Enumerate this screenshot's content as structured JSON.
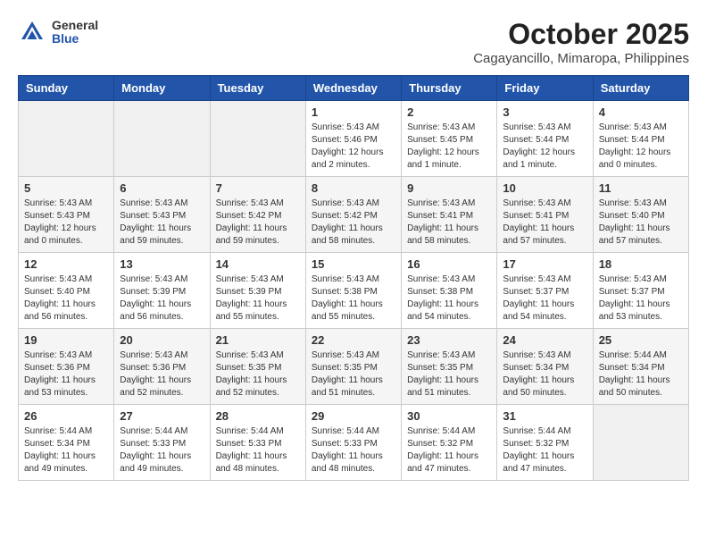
{
  "header": {
    "logo_general": "General",
    "logo_blue": "Blue",
    "month": "October 2025",
    "location": "Cagayancillo, Mimaropa, Philippines"
  },
  "weekdays": [
    "Sunday",
    "Monday",
    "Tuesday",
    "Wednesday",
    "Thursday",
    "Friday",
    "Saturday"
  ],
  "weeks": [
    [
      {
        "day": "",
        "info": ""
      },
      {
        "day": "",
        "info": ""
      },
      {
        "day": "",
        "info": ""
      },
      {
        "day": "1",
        "info": "Sunrise: 5:43 AM\nSunset: 5:46 PM\nDaylight: 12 hours\nand 2 minutes."
      },
      {
        "day": "2",
        "info": "Sunrise: 5:43 AM\nSunset: 5:45 PM\nDaylight: 12 hours\nand 1 minute."
      },
      {
        "day": "3",
        "info": "Sunrise: 5:43 AM\nSunset: 5:44 PM\nDaylight: 12 hours\nand 1 minute."
      },
      {
        "day": "4",
        "info": "Sunrise: 5:43 AM\nSunset: 5:44 PM\nDaylight: 12 hours\nand 0 minutes."
      }
    ],
    [
      {
        "day": "5",
        "info": "Sunrise: 5:43 AM\nSunset: 5:43 PM\nDaylight: 12 hours\nand 0 minutes."
      },
      {
        "day": "6",
        "info": "Sunrise: 5:43 AM\nSunset: 5:43 PM\nDaylight: 11 hours\nand 59 minutes."
      },
      {
        "day": "7",
        "info": "Sunrise: 5:43 AM\nSunset: 5:42 PM\nDaylight: 11 hours\nand 59 minutes."
      },
      {
        "day": "8",
        "info": "Sunrise: 5:43 AM\nSunset: 5:42 PM\nDaylight: 11 hours\nand 58 minutes."
      },
      {
        "day": "9",
        "info": "Sunrise: 5:43 AM\nSunset: 5:41 PM\nDaylight: 11 hours\nand 58 minutes."
      },
      {
        "day": "10",
        "info": "Sunrise: 5:43 AM\nSunset: 5:41 PM\nDaylight: 11 hours\nand 57 minutes."
      },
      {
        "day": "11",
        "info": "Sunrise: 5:43 AM\nSunset: 5:40 PM\nDaylight: 11 hours\nand 57 minutes."
      }
    ],
    [
      {
        "day": "12",
        "info": "Sunrise: 5:43 AM\nSunset: 5:40 PM\nDaylight: 11 hours\nand 56 minutes."
      },
      {
        "day": "13",
        "info": "Sunrise: 5:43 AM\nSunset: 5:39 PM\nDaylight: 11 hours\nand 56 minutes."
      },
      {
        "day": "14",
        "info": "Sunrise: 5:43 AM\nSunset: 5:39 PM\nDaylight: 11 hours\nand 55 minutes."
      },
      {
        "day": "15",
        "info": "Sunrise: 5:43 AM\nSunset: 5:38 PM\nDaylight: 11 hours\nand 55 minutes."
      },
      {
        "day": "16",
        "info": "Sunrise: 5:43 AM\nSunset: 5:38 PM\nDaylight: 11 hours\nand 54 minutes."
      },
      {
        "day": "17",
        "info": "Sunrise: 5:43 AM\nSunset: 5:37 PM\nDaylight: 11 hours\nand 54 minutes."
      },
      {
        "day": "18",
        "info": "Sunrise: 5:43 AM\nSunset: 5:37 PM\nDaylight: 11 hours\nand 53 minutes."
      }
    ],
    [
      {
        "day": "19",
        "info": "Sunrise: 5:43 AM\nSunset: 5:36 PM\nDaylight: 11 hours\nand 53 minutes."
      },
      {
        "day": "20",
        "info": "Sunrise: 5:43 AM\nSunset: 5:36 PM\nDaylight: 11 hours\nand 52 minutes."
      },
      {
        "day": "21",
        "info": "Sunrise: 5:43 AM\nSunset: 5:35 PM\nDaylight: 11 hours\nand 52 minutes."
      },
      {
        "day": "22",
        "info": "Sunrise: 5:43 AM\nSunset: 5:35 PM\nDaylight: 11 hours\nand 51 minutes."
      },
      {
        "day": "23",
        "info": "Sunrise: 5:43 AM\nSunset: 5:35 PM\nDaylight: 11 hours\nand 51 minutes."
      },
      {
        "day": "24",
        "info": "Sunrise: 5:43 AM\nSunset: 5:34 PM\nDaylight: 11 hours\nand 50 minutes."
      },
      {
        "day": "25",
        "info": "Sunrise: 5:44 AM\nSunset: 5:34 PM\nDaylight: 11 hours\nand 50 minutes."
      }
    ],
    [
      {
        "day": "26",
        "info": "Sunrise: 5:44 AM\nSunset: 5:34 PM\nDaylight: 11 hours\nand 49 minutes."
      },
      {
        "day": "27",
        "info": "Sunrise: 5:44 AM\nSunset: 5:33 PM\nDaylight: 11 hours\nand 49 minutes."
      },
      {
        "day": "28",
        "info": "Sunrise: 5:44 AM\nSunset: 5:33 PM\nDaylight: 11 hours\nand 48 minutes."
      },
      {
        "day": "29",
        "info": "Sunrise: 5:44 AM\nSunset: 5:33 PM\nDaylight: 11 hours\nand 48 minutes."
      },
      {
        "day": "30",
        "info": "Sunrise: 5:44 AM\nSunset: 5:32 PM\nDaylight: 11 hours\nand 47 minutes."
      },
      {
        "day": "31",
        "info": "Sunrise: 5:44 AM\nSunset: 5:32 PM\nDaylight: 11 hours\nand 47 minutes."
      },
      {
        "day": "",
        "info": ""
      }
    ]
  ]
}
